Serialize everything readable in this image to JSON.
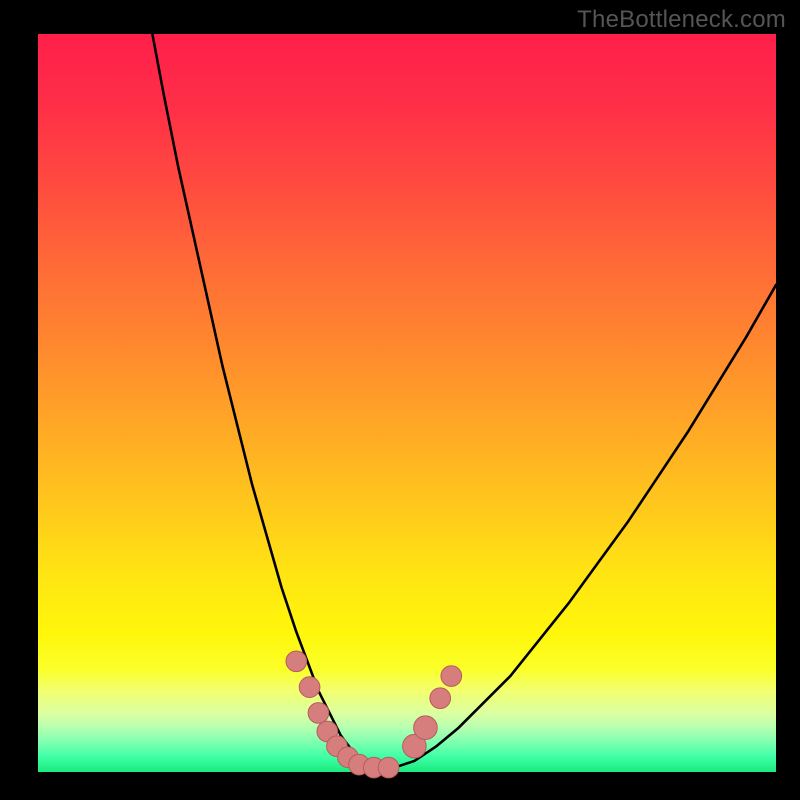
{
  "watermark": "TheBottleneck.com",
  "colors": {
    "frame": "#000000",
    "curve": "#000000",
    "marker_fill": "#d67d7d",
    "marker_stroke": "#b85b5b"
  },
  "chart_data": {
    "type": "line",
    "title": "",
    "xlabel": "",
    "ylabel": "",
    "xlim": [
      0,
      100
    ],
    "ylim": [
      0,
      100
    ],
    "grid": false,
    "series": [
      {
        "name": "bottleneck-curve",
        "x": [
          15.5,
          17,
          19,
          21,
          23,
          25,
          27,
          29,
          31,
          33,
          35,
          36.5,
          38,
          39.5,
          41,
          42.5,
          44,
          46,
          48,
          51,
          54,
          57,
          60,
          64,
          68,
          72,
          76,
          80,
          84,
          88,
          92,
          96,
          100
        ],
        "y": [
          100,
          92,
          82,
          73,
          64,
          55,
          47,
          39,
          32,
          25,
          19,
          15,
          11,
          8,
          5,
          3,
          1.5,
          0.5,
          0.5,
          1.5,
          3.5,
          6,
          9,
          13,
          18,
          23,
          28.5,
          34,
          40,
          46,
          52.5,
          59,
          66
        ]
      }
    ],
    "markers": [
      {
        "x": 35.0,
        "y": 15.0,
        "r": 1.4
      },
      {
        "x": 36.8,
        "y": 11.5,
        "r": 1.4
      },
      {
        "x": 38.0,
        "y": 8.0,
        "r": 1.4
      },
      {
        "x": 39.2,
        "y": 5.5,
        "r": 1.4
      },
      {
        "x": 40.5,
        "y": 3.5,
        "r": 1.4
      },
      {
        "x": 42.0,
        "y": 2.0,
        "r": 1.4
      },
      {
        "x": 43.5,
        "y": 1.0,
        "r": 1.4
      },
      {
        "x": 45.5,
        "y": 0.6,
        "r": 1.4
      },
      {
        "x": 47.5,
        "y": 0.6,
        "r": 1.4
      },
      {
        "x": 51.0,
        "y": 3.5,
        "r": 1.6
      },
      {
        "x": 52.5,
        "y": 6.0,
        "r": 1.6
      },
      {
        "x": 54.5,
        "y": 10.0,
        "r": 1.4
      },
      {
        "x": 56.0,
        "y": 13.0,
        "r": 1.4
      }
    ]
  }
}
